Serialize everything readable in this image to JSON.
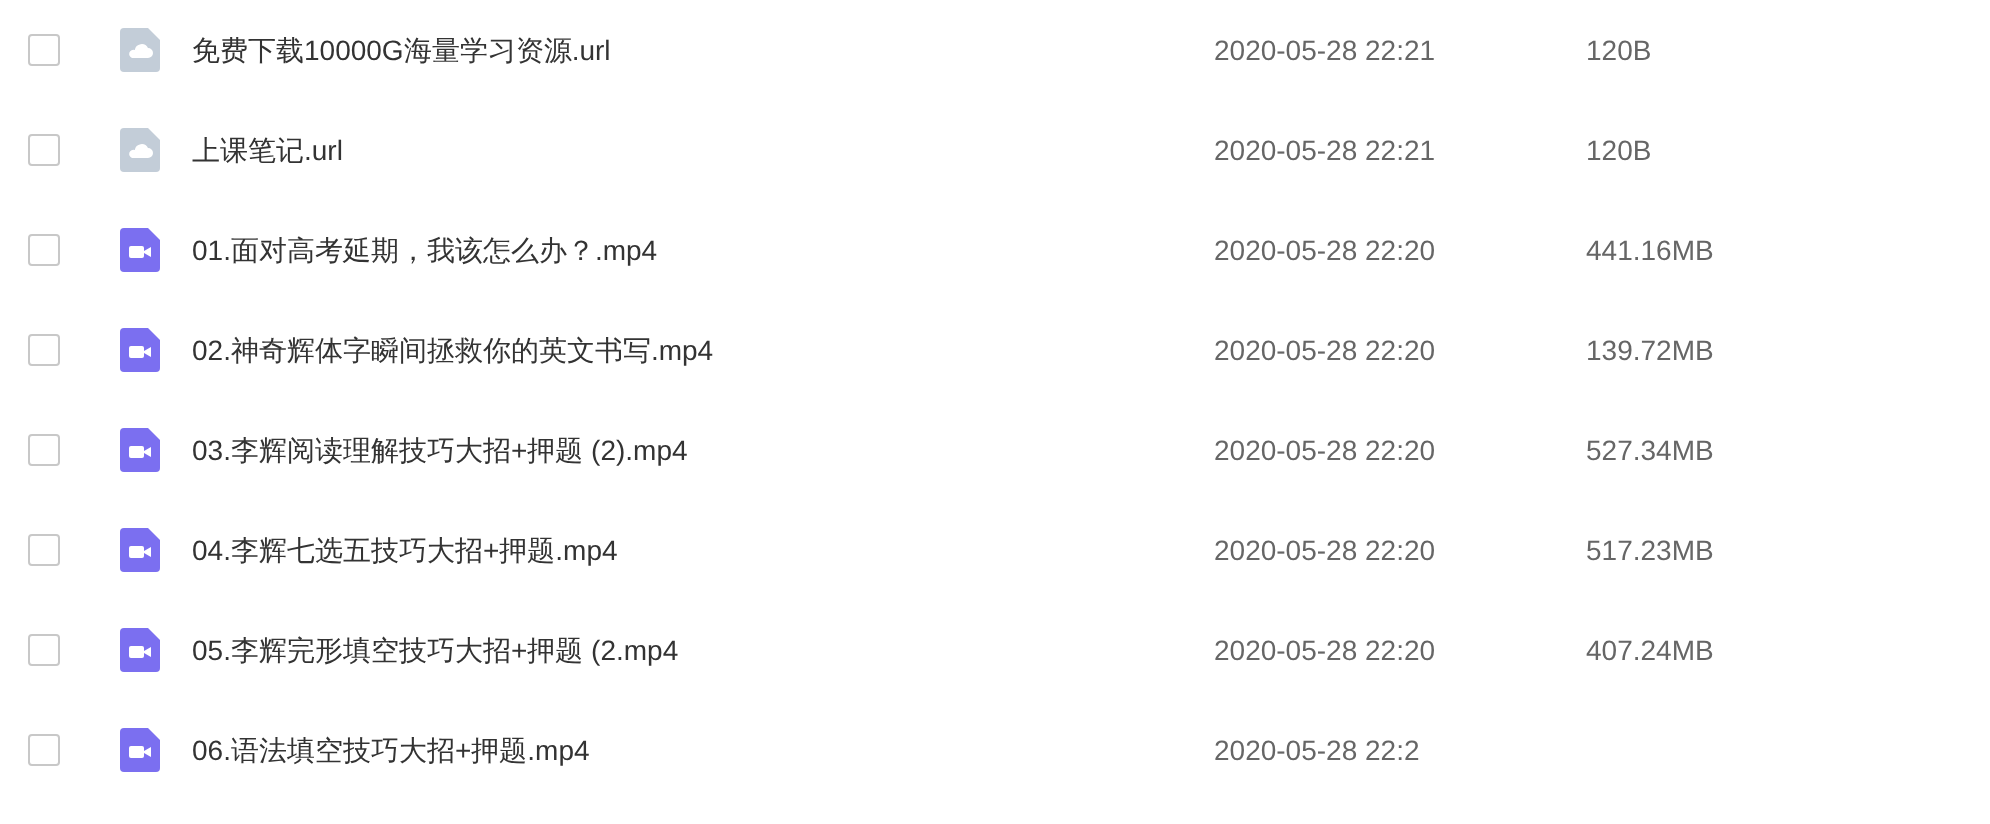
{
  "files": [
    {
      "kind": "link",
      "name": "免费下载10000G海量学习资源.url",
      "modified": "2020-05-28 22:21",
      "size": "120B",
      "checked": false
    },
    {
      "kind": "link",
      "name": "上课笔记.url",
      "modified": "2020-05-28 22:21",
      "size": "120B",
      "checked": false
    },
    {
      "kind": "video",
      "name": "01.面对高考延期，我该怎么办？.mp4",
      "modified": "2020-05-28 22:20",
      "size": "441.16MB",
      "checked": false
    },
    {
      "kind": "video",
      "name": "02.神奇辉体字瞬间拯救你的英文书写.mp4",
      "modified": "2020-05-28 22:20",
      "size": "139.72MB",
      "checked": false
    },
    {
      "kind": "video",
      "name": "03.李辉阅读理解技巧大招+押题 (2).mp4",
      "modified": "2020-05-28 22:20",
      "size": "527.34MB",
      "checked": false
    },
    {
      "kind": "video",
      "name": "04.李辉七选五技巧大招+押题.mp4",
      "modified": "2020-05-28 22:20",
      "size": "517.23MB",
      "checked": false
    },
    {
      "kind": "video",
      "name": "05.李辉完形填空技巧大招+押题 (2.mp4",
      "modified": "2020-05-28 22:20",
      "size": "407.24MB",
      "checked": false
    },
    {
      "kind": "video",
      "name": "06.语法填空技巧大招+押题.mp4",
      "modified": "2020-05-28 22:2",
      "checked": false
    }
  ]
}
